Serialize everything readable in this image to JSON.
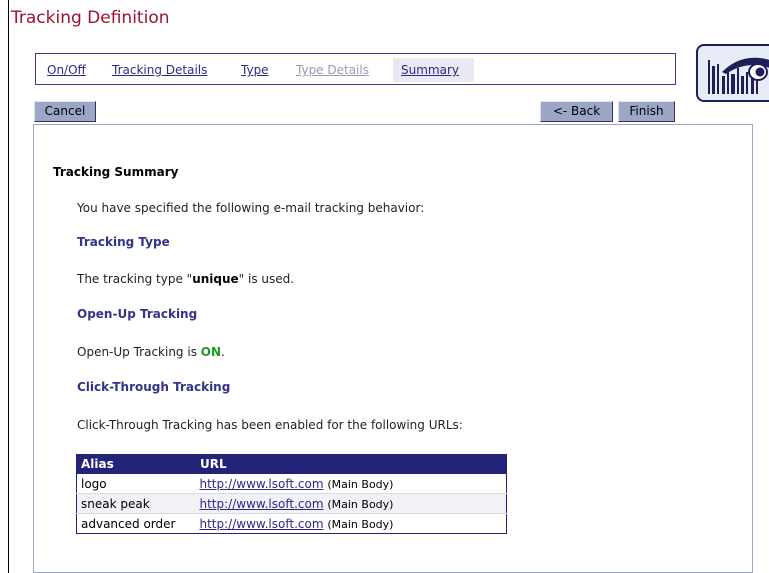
{
  "page": {
    "title": "Tracking Definition"
  },
  "tabs": [
    {
      "label": "On/Off",
      "state": "enabled"
    },
    {
      "label": "Tracking Details",
      "state": "enabled"
    },
    {
      "label": "Type",
      "state": "enabled"
    },
    {
      "label": "Type Details",
      "state": "disabled"
    },
    {
      "label": "Summary",
      "state": "active"
    }
  ],
  "buttons": {
    "cancel": "Cancel",
    "back": "<- Back",
    "finish": "Finish"
  },
  "summary": {
    "heading": "Tracking Summary",
    "intro": "You have specified the following e-mail tracking behavior:",
    "tracking_type": {
      "heading": "Tracking Type",
      "prefix": "The tracking type \"",
      "value": "unique",
      "suffix": "\" is used."
    },
    "open_up": {
      "heading": "Open-Up Tracking",
      "prefix": "Open-Up Tracking is ",
      "value": "ON",
      "suffix": "."
    },
    "click_through": {
      "heading": "Click-Through Tracking",
      "text": "Click-Through Tracking has been enabled for the following URLs:"
    }
  },
  "url_table": {
    "columns": [
      "Alias",
      "URL"
    ],
    "rows": [
      {
        "alias": "logo",
        "url": "http://www.lsoft.com",
        "note": "(Main Body)"
      },
      {
        "alias": "sneak peak",
        "url": "http://www.lsoft.com",
        "note": "(Main Body)"
      },
      {
        "alias": "advanced order",
        "url": "http://www.lsoft.com",
        "note": "(Main Body)"
      }
    ]
  },
  "colors": {
    "title": "#a0112f",
    "link": "#2a2a8a",
    "section_heading": "#33338a",
    "table_header": "#23237a",
    "on_status": "#1e9b1e",
    "button": "#9ea6c7"
  },
  "icons": {
    "logo": "eye-over-barcode-logo"
  }
}
